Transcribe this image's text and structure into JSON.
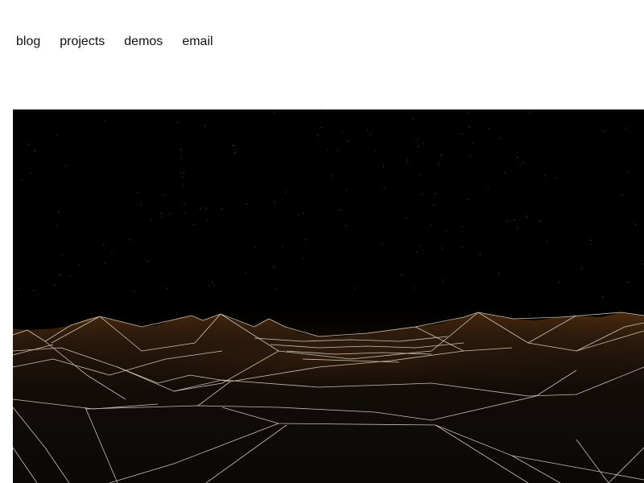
{
  "nav": {
    "links": [
      {
        "label": "blog"
      },
      {
        "label": "projects"
      },
      {
        "label": "demos"
      },
      {
        "label": "email"
      }
    ]
  },
  "canvas": {
    "background": "#000000",
    "terrain_fill": "#3a2410",
    "terrain_shadow": "#0c0908",
    "wire_color": "#e9e0d6",
    "star_color": "#5a5a5a"
  }
}
